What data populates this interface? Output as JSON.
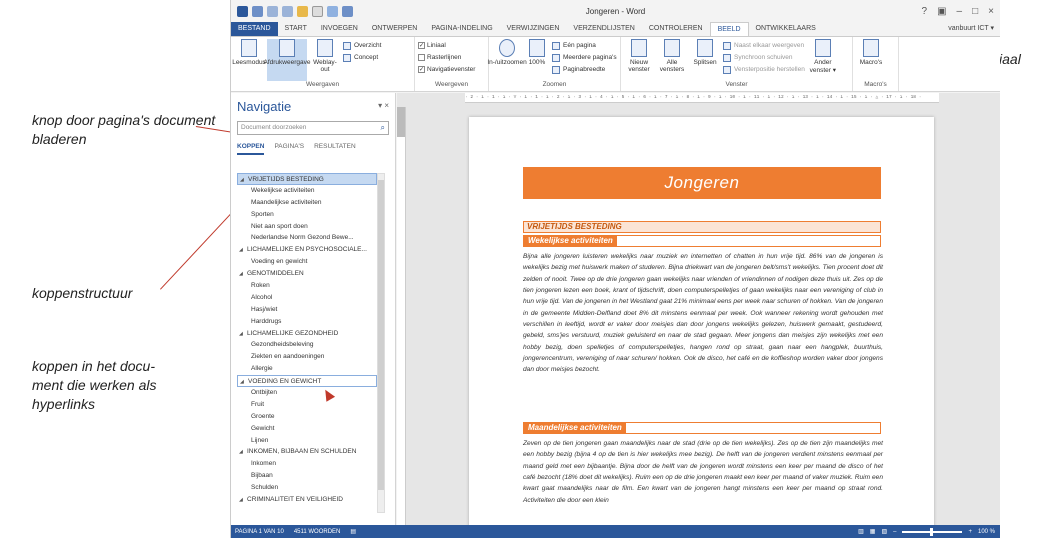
{
  "annotations": {
    "scroll_button": "knop door pagina's document bladeren",
    "heading_structure": "koppenstructuur",
    "hyperlinks": "koppen in het docu-\nment die werken als\nhyperlinks",
    "ruler": "liniaal"
  },
  "titlebar": {
    "title": "Jongeren - Word",
    "help": "?",
    "minimize": "–",
    "restore": "□",
    "close": "×"
  },
  "tabs": [
    "BESTAND",
    "START",
    "INVOEGEN",
    "ONTWERPEN",
    "PAGINA-INDELING",
    "VERWIJZINGEN",
    "VERZENDLIJSTEN",
    "CONTROLEREN",
    "BEELD",
    "ONTWIKKELAARS"
  ],
  "active_tab": "BEELD",
  "user": "vanbuurt ICT ▾",
  "ribbon": {
    "weergaven": {
      "label": "Weergaven",
      "leesmodus": "Leesmodus",
      "afdrukweergave": "Afdrukweergave",
      "weblay": "Weblay-out",
      "overzicht": "Overzicht",
      "concept": "Concept"
    },
    "weergeven": {
      "label": "Weergeven",
      "liniaal": "Liniaal",
      "rasterlijnen": "Rasterlijnen",
      "navigatievenster": "Navigatievenster"
    },
    "zoomen": {
      "label": "Zoomen",
      "inuitzoomen": "In-/uitzoomen",
      "pct": "100%",
      "een_pagina": "Eén pagina",
      "meerdere": "Meerdere pagina's",
      "paginabreedte": "Paginabreedte"
    },
    "venster": {
      "label": "Venster",
      "nieuw": "Nieuw venster",
      "alle": "Alle vensters",
      "splitsen": "Splitsen",
      "naast": "Naast elkaar weergeven",
      "synchroon": "Synchroon schuiven",
      "herstellen": "Vensterpositie herstellen",
      "ander": "Ander venster ▾"
    },
    "macros": {
      "label": "Macro's",
      "btn": "Macro's"
    }
  },
  "nav": {
    "title": "Navigatie",
    "search_placeholder": "Document doorzoeken",
    "tabs": [
      "KOPPEN",
      "PAGINA'S",
      "RESULTATEN"
    ],
    "items": [
      {
        "text": "VRIJETIJDS BESTEDING",
        "level": 1
      },
      {
        "text": "Wekelijkse activiteiten",
        "level": 2
      },
      {
        "text": "Maandelijkse activiteiten",
        "level": 2
      },
      {
        "text": "Sporten",
        "level": 2
      },
      {
        "text": "Niet aan sport doen",
        "level": 2
      },
      {
        "text": "Nederlandse Norm Gezond Bewe...",
        "level": 2
      },
      {
        "text": "LICHAMELIJKE EN PSYCHOSOCIALE...",
        "level": 1
      },
      {
        "text": "Voeding en gewicht",
        "level": 2
      },
      {
        "text": "GENOTMIDDELEN",
        "level": 1
      },
      {
        "text": "Roken",
        "level": 2
      },
      {
        "text": "Alcohol",
        "level": 2
      },
      {
        "text": "Hasj/wiet",
        "level": 2
      },
      {
        "text": "Harddrugs",
        "level": 2
      },
      {
        "text": "LICHAMELIJKE GEZONDHEID",
        "level": 1
      },
      {
        "text": "Gezondheidsbeleving",
        "level": 2
      },
      {
        "text": "Ziekten en aandoeningen",
        "level": 2
      },
      {
        "text": "Allergie",
        "level": 2
      },
      {
        "text": "VOEDING EN GEWICHT",
        "level": 1
      },
      {
        "text": "Ontbijten",
        "level": 2
      },
      {
        "text": "Fruit",
        "level": 2
      },
      {
        "text": "Groente",
        "level": 2
      },
      {
        "text": "Gewicht",
        "level": 2
      },
      {
        "text": "Lijnen",
        "level": 2
      },
      {
        "text": "INKOMEN, BIJBAAN EN SCHULDEN",
        "level": 1
      },
      {
        "text": "Inkomen",
        "level": 2
      },
      {
        "text": "Bijbaan",
        "level": 2
      },
      {
        "text": "Schulden",
        "level": 2
      },
      {
        "text": "CRIMINALITEIT EN VEILIGHEID",
        "level": 1
      }
    ]
  },
  "ruler_text": "· 2 · ı · 1 · ı · ▽ · ı · 1 · ı · 2 · ı · 3 · ı · 4 · ı · 5 · ı · 6 · ı · 7 · ı · 8 · ı · 9 · ı · 10 · ı · 11 · ı · 12 · ı · 13 · ı · 14 · ı · 15 · ı · △ · 17 · ı · 18 ·",
  "document": {
    "banner": "Jongeren",
    "h1": "VRIJETIJDS BESTEDING",
    "h2a": "Wekelijkse activiteiten",
    "p1": "Bijna alle jongeren luisteren wekelijks naar muziek en internetten of chatten in hun vrije tijd. 86% van de jongeren is wekelijks bezig met huiswerk maken of studeren. Bijna driekwart van de jongeren belt/sms't wekelijks. Tien procent doet dit zelden of nooit. Twee op de drie jongeren gaan wekelijks naar vrienden of vriendinnen of nodigen deze thuis uit. Zes op de tien jongeren lezen een boek, krant of tijdschrift, doen computerspelletjes of gaan wekelijks naar een vereniging of club in hun vrije tijd. Van de jongeren in het Westland gaat 21% minimaal eens per week naar schuren of hokken. Van de jongeren in de gemeente Midden-Delfland doet 8% dit minstens eenmaal per week. Ook wanneer rekening wordt gehouden met verschillen in leeftijd, wordt er vaker door meisjes dan door jongens wekelijks gelezen, huiswerk gemaakt, gestudeerd, gebeld, sms'jes verstuurd, muziek geluisterd en naar de stad gegaan. Meer jongens dan meisjes zijn wekelijks met een hobby bezig, doen spelletjes of computerspelletjes, hangen rond op straat, gaan naar een hangplek, buurthuis, jongerencentrum, vereniging of naar schuren/ hokken. Ook de disco, het café en de koffieshop worden vaker door jongens dan door meisjes bezocht.",
    "h2b": "Maandelijkse activiteiten",
    "p2": "Zeven op de tien jongeren gaan maandelijks naar de stad (drie op de tien wekelijks). Zes op de tien zijn maandelijks met een hobby bezig (bijna 4 op de tien is hier wekelijks mee bezig). De helft van de jongeren verdient minstens eenmaal per maand geld met een bijbaantje. Bijna door de helft van de jongeren wordt minstens een keer per maand de disco of het café bezocht (18% doet dit wekelijks). Ruim een op de drie jongeren maakt een keer per maand of vaker muziek. Ruim een kwart gaat maandelijks naar de film. Een kwart van de jongeren hangt minstens een keer per maand op straat rond. Activiteiten die door een klein"
  },
  "status": {
    "page": "PAGINA 1 VAN 10",
    "words": "4511 WOORDEN",
    "zoom": "100 %"
  }
}
